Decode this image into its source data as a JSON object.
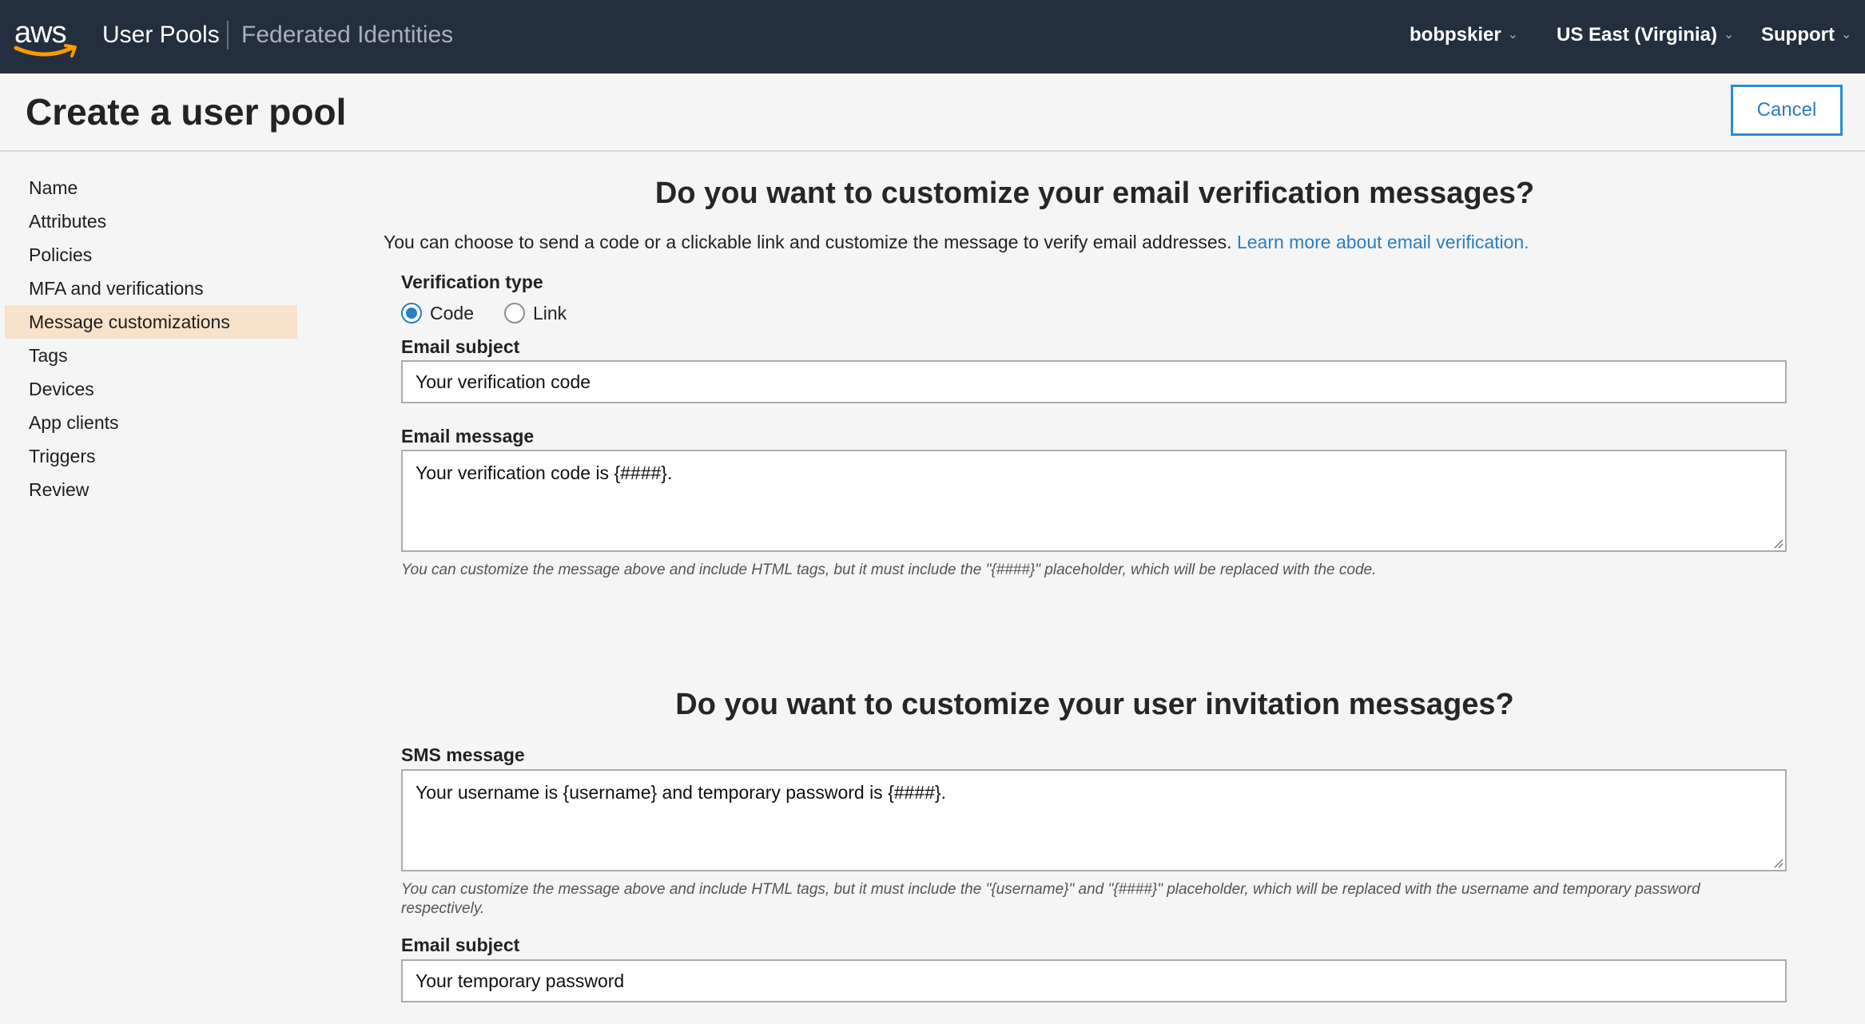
{
  "topnav": {
    "logo_text": "aws",
    "user_pools": "User Pools",
    "federated_identities": "Federated Identities",
    "account": "bobpskier",
    "region": "US East (Virginia)",
    "support": "Support"
  },
  "header": {
    "title": "Create a user pool",
    "cancel_label": "Cancel"
  },
  "sidebar": {
    "items": [
      {
        "label": "Name"
      },
      {
        "label": "Attributes"
      },
      {
        "label": "Policies"
      },
      {
        "label": "MFA and verifications"
      },
      {
        "label": "Message customizations",
        "active": true
      },
      {
        "label": "Tags"
      },
      {
        "label": "Devices"
      },
      {
        "label": "App clients"
      },
      {
        "label": "Triggers"
      },
      {
        "label": "Review"
      }
    ]
  },
  "email_verification": {
    "heading": "Do you want to customize your email verification messages?",
    "intro": "You can choose to send a code or a clickable link and customize the message to verify email addresses.",
    "learn_more": "Learn more about email verification.",
    "verification_type_label": "Verification type",
    "options": [
      {
        "label": "Code",
        "selected": true
      },
      {
        "label": "Link",
        "selected": false
      }
    ],
    "email_subject_label": "Email subject",
    "email_subject_value": "Your verification code",
    "email_message_label": "Email message",
    "email_message_value": "Your verification code is {####}.",
    "help": "You can customize the message above and include HTML tags, but it must include the \"{####}\" placeholder, which will be replaced with the code."
  },
  "user_invitation": {
    "heading": "Do you want to customize your user invitation messages?",
    "sms_label": "SMS message",
    "sms_value": "Your username is {username} and temporary password is {####}.",
    "help": "You can customize the message above and include HTML tags, but it must include the \"{username}\" and \"{####}\" placeholder, which will be replaced with the username and temporary password respectively.",
    "email_subject_label": "Email subject",
    "email_subject_value": "Your temporary password"
  },
  "colors": {
    "nav_bg": "#232f3e",
    "accent": "#2b7ec2",
    "active_nav": "#f8e2cb",
    "aws_orange": "#ff9900"
  }
}
